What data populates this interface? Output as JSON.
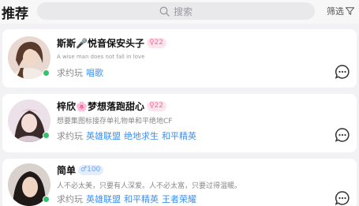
{
  "header": {
    "title": "推荐",
    "search_placeholder": "搜索",
    "filter_label": "筛选"
  },
  "cards": [
    {
      "name": "斯斯🎤悦音保安头子",
      "badge_gender": "female",
      "badge_value": "22",
      "bio": "A wise man does not fall in love",
      "games_label": "求约玩",
      "games": [
        "唱歌"
      ],
      "online": true
    },
    {
      "name": "梓欣🌸梦想落跑甜心",
      "badge_gender": "female",
      "badge_value": "22",
      "bio": "想要集图标接存单礼物单和平绝地CF",
      "games_label": "求约玩",
      "games": [
        "英雄联盟",
        "绝地求生",
        "和平精英"
      ],
      "online": true
    },
    {
      "name": "简单",
      "badge_gender": "male",
      "badge_value": "100",
      "bio": "人不必太美，只要有人深爱。人不必太富，只要过得温暖。",
      "games_label": "求约玩",
      "games": [
        "英雄联盟",
        "和平精英",
        "王者荣耀"
      ],
      "online": true
    }
  ],
  "colors": {
    "accent_blue": "#3d8ff5",
    "badge_pink": "#f46f9c",
    "online_green": "#32c36c"
  }
}
